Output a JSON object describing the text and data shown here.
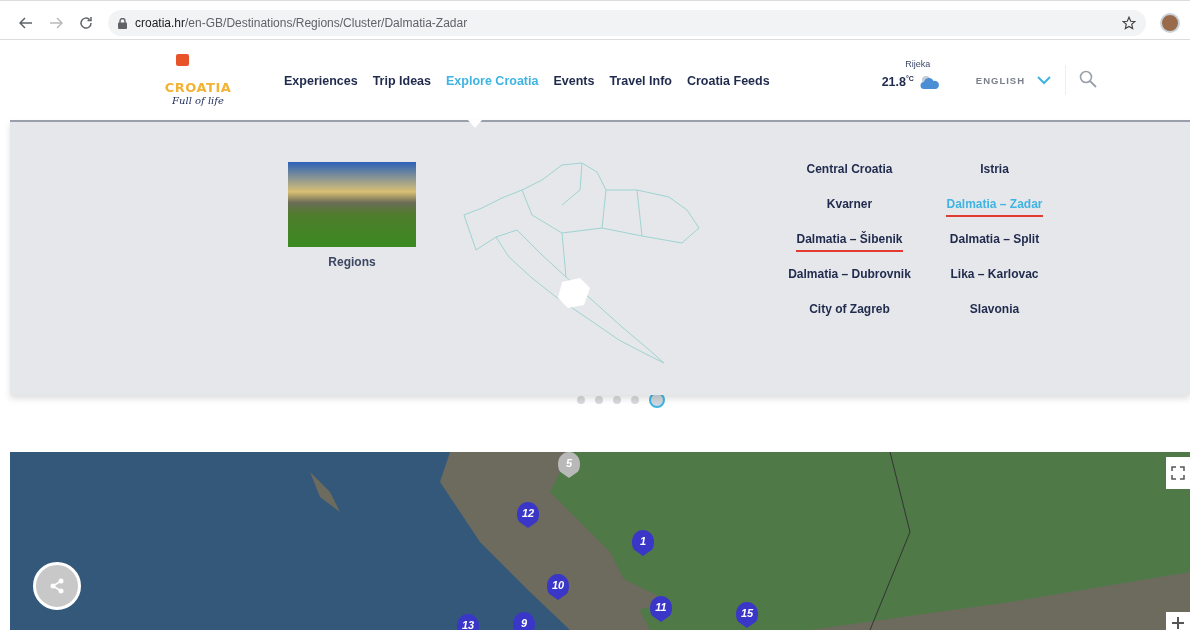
{
  "browser": {
    "url_domain": "croatia.hr",
    "url_path": "/en-GB/Destinations/Regions/Cluster/Dalmatia-Zadar"
  },
  "header": {
    "logo": {
      "word": "CROATIA",
      "tagline": "Full of life"
    },
    "nav": [
      {
        "label": "Experiences",
        "selected": false
      },
      {
        "label": "Trip Ideas",
        "selected": false
      },
      {
        "label": "Explore Croatia",
        "selected": true
      },
      {
        "label": "Events",
        "selected": false
      },
      {
        "label": "Travel Info",
        "selected": false
      },
      {
        "label": "Croatia Feeds",
        "selected": false
      }
    ],
    "weather": {
      "city": "Rijeka",
      "temperature": "21.8",
      "unit": "°C"
    },
    "language": "ENGLISH"
  },
  "mega_menu": {
    "card": {
      "title": "Regions"
    },
    "regions": [
      {
        "label": "Central Croatia",
        "selected": false,
        "underlined": false
      },
      {
        "label": "Istria",
        "selected": false,
        "underlined": false
      },
      {
        "label": "Kvarner",
        "selected": false,
        "underlined": false
      },
      {
        "label": "Dalmatia – Zadar",
        "selected": true,
        "underlined": true
      },
      {
        "label": "Dalmatia – Šibenik",
        "selected": false,
        "underlined": true
      },
      {
        "label": "Dalmatia – Split",
        "selected": false,
        "underlined": false
      },
      {
        "label": "Dalmatia – Dubrovnik",
        "selected": false,
        "underlined": false
      },
      {
        "label": "Lika – Karlovac",
        "selected": false,
        "underlined": false
      },
      {
        "label": "City of Zagreb",
        "selected": false,
        "underlined": false
      },
      {
        "label": "Slavonia",
        "selected": false,
        "underlined": false
      }
    ]
  },
  "carousel_dots": [
    {
      "selected": false
    },
    {
      "selected": false
    },
    {
      "selected": false
    },
    {
      "selected": false
    },
    {
      "selected": true
    }
  ],
  "map": {
    "pins": [
      {
        "number": "5",
        "color": "#b9b9b9"
      },
      {
        "number": "12",
        "color": "#3a36c8"
      },
      {
        "number": "1",
        "color": "#3a36c8"
      },
      {
        "number": "10",
        "color": "#3a36c8"
      },
      {
        "number": "11",
        "color": "#3a36c8"
      },
      {
        "number": "15",
        "color": "#3a36c8"
      },
      {
        "number": "13",
        "color": "#3a36c8"
      },
      {
        "number": "9",
        "color": "#3a36c8"
      }
    ]
  }
}
